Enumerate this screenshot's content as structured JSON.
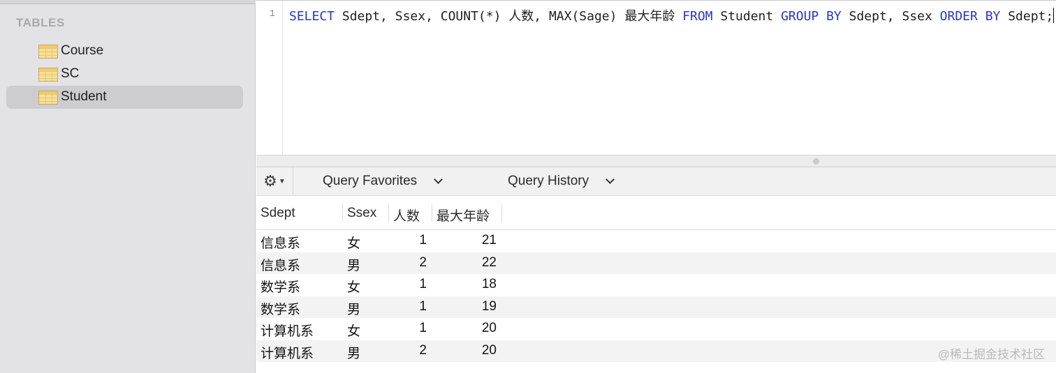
{
  "sidebar": {
    "section_title": "TABLES",
    "tables": [
      {
        "label": "Course",
        "selected": false,
        "icon": "table-icon"
      },
      {
        "label": "SC",
        "selected": false,
        "icon": "table-icon"
      },
      {
        "label": "Student",
        "selected": true,
        "icon": "table-icon"
      }
    ]
  },
  "editor": {
    "line_number": "1",
    "tokens": [
      {
        "text": "SELECT",
        "kw": true
      },
      {
        "text": " Sdept, Ssex, COUNT(*) 人数, MAX(Sage) 最大年龄 ",
        "kw": false
      },
      {
        "text": "FROM",
        "kw": true
      },
      {
        "text": " Student ",
        "kw": false
      },
      {
        "text": "GROUP BY",
        "kw": true
      },
      {
        "text": " Sdept, Ssex ",
        "kw": false
      },
      {
        "text": "ORDER BY",
        "kw": true
      },
      {
        "text": " Sdept;",
        "kw": false
      }
    ],
    "keyword_color": "#2a35c8"
  },
  "toolbar": {
    "gear_icon": "gear-icon",
    "favorites_label": "Query Favorites",
    "history_label": "Query History"
  },
  "results": {
    "columns": [
      "Sdept",
      "Ssex",
      "人数",
      "最大年龄"
    ],
    "rows": [
      [
        "信息系",
        "女",
        "1",
        "21"
      ],
      [
        "信息系",
        "男",
        "2",
        "22"
      ],
      [
        "数学系",
        "女",
        "1",
        "18"
      ],
      [
        "数学系",
        "男",
        "1",
        "19"
      ],
      [
        "计算机系",
        "女",
        "1",
        "20"
      ],
      [
        "计算机系",
        "男",
        "2",
        "20"
      ]
    ]
  },
  "watermark": "@稀土掘金技术社区"
}
